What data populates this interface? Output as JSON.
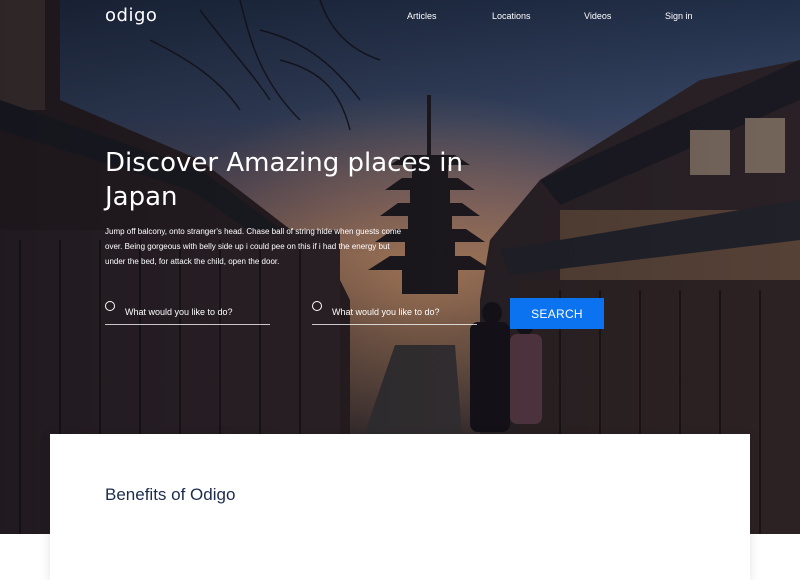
{
  "brand": {
    "logo_text": "odigo"
  },
  "nav": {
    "items": [
      {
        "label": "Articles"
      },
      {
        "label": "Locations"
      },
      {
        "label": "Videos"
      },
      {
        "label": "Sign in"
      }
    ]
  },
  "hero": {
    "headline": "Discover Amazing places in Japan",
    "subtitle": "Jump off balcony, onto stranger's head. Chase ball of string hide when guests come over. Being gorgeous with belly side up i could pee on this if i had the energy but under the bed, for attack the child, open the door.",
    "background_image": "kyoto-street-pagoda-dusk"
  },
  "search": {
    "field_1": {
      "placeholder": "What would you like to do?",
      "value": ""
    },
    "field_2": {
      "placeholder": "What would you like to do?",
      "value": ""
    },
    "button_label": "SEARCH"
  },
  "benefits": {
    "title": "Benefits of Odigo"
  },
  "colors": {
    "accent": "#0b73f0",
    "heading_dark": "#1c2c4c",
    "text_light": "#ffffff"
  },
  "icons": {
    "field_icon": "radio-circle-icon"
  }
}
